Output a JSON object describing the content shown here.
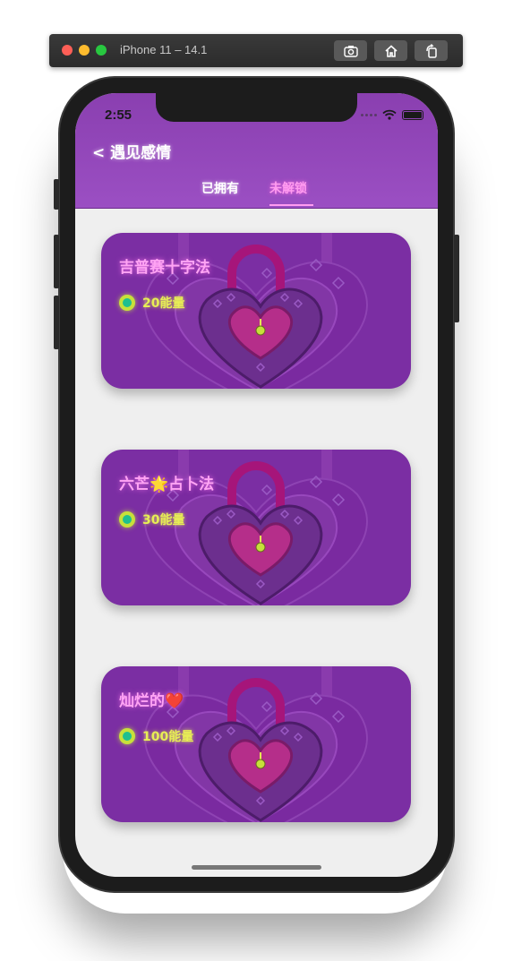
{
  "simulator": {
    "title": "iPhone 11 – 14.1",
    "buttons": [
      "screenshot-icon",
      "home-icon",
      "rotate-icon"
    ]
  },
  "status_bar": {
    "time": "2:55"
  },
  "nav": {
    "back_label": "< 遇见感情"
  },
  "tabs": [
    {
      "label": "已拥有",
      "active": false
    },
    {
      "label": "未解锁",
      "active": true
    }
  ],
  "cards": [
    {
      "title": "吉普赛十字法",
      "energy": "20能量"
    },
    {
      "title": "六芒🌟占卜法",
      "energy": "30能量"
    },
    {
      "title": "灿烂的❤️",
      "energy": "100能量"
    }
  ],
  "colors": {
    "header": "#9b4fc3",
    "card": "#7b2ea3",
    "title_text": "#ffa4f4",
    "energy_text": "#e7ee55",
    "active_tab": "#ff9cf0"
  }
}
